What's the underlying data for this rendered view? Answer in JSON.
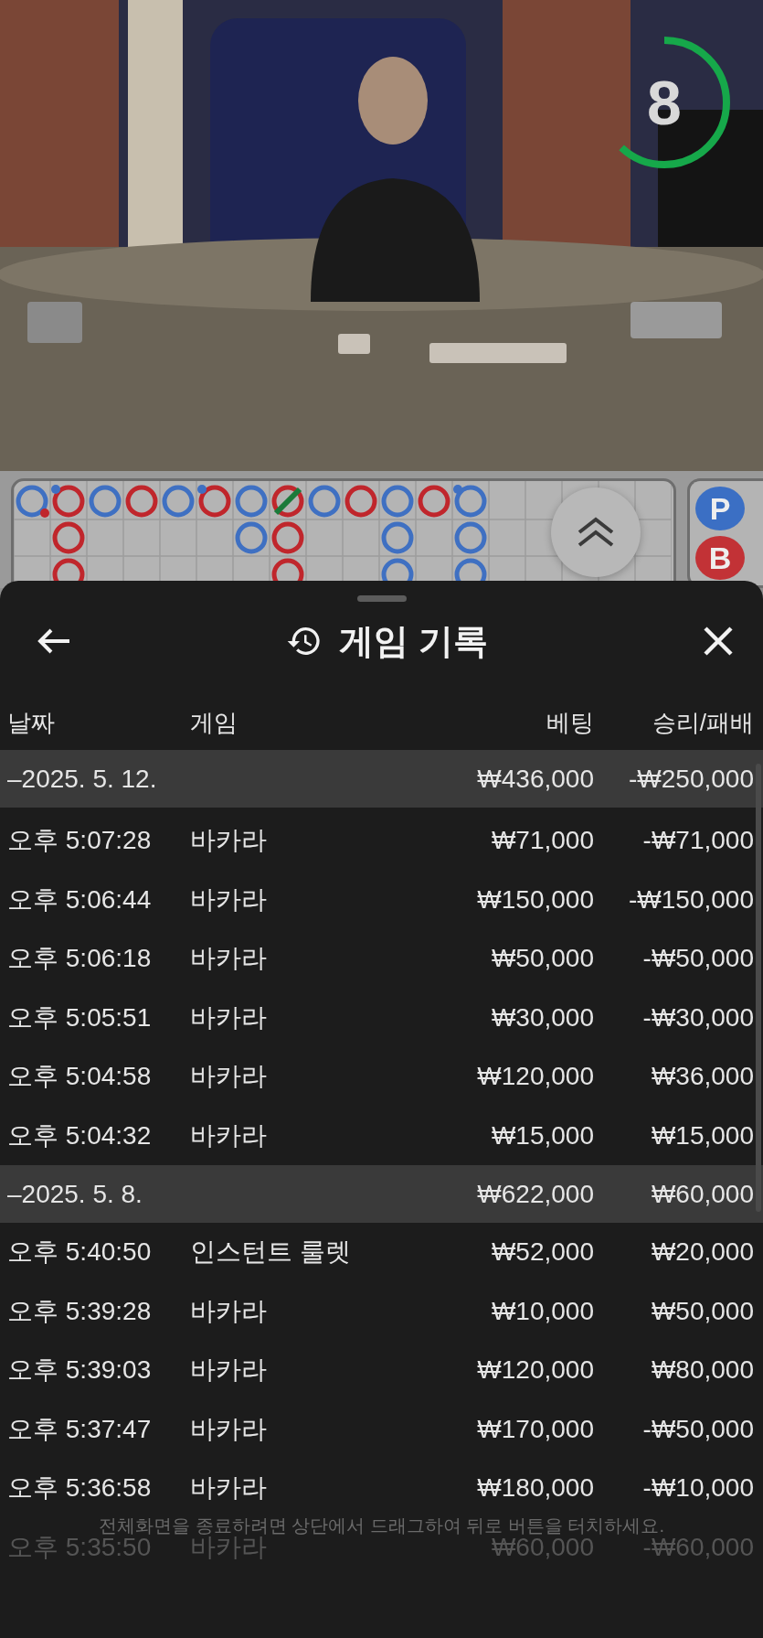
{
  "video": {
    "countdown": {
      "value": "8",
      "level": 0.62
    }
  },
  "scoreboard": {
    "columns": [
      [
        {
          "kind": "player-with-banker-pair"
        }
      ],
      [
        {
          "kind": "banker-with-player-pair"
        },
        {
          "kind": "banker"
        },
        {
          "kind": "banker"
        }
      ],
      [
        {
          "kind": "player"
        }
      ],
      [
        {
          "kind": "banker"
        }
      ],
      [
        {
          "kind": "player"
        }
      ],
      [
        {
          "kind": "banker-with-player-pair"
        }
      ],
      [
        {
          "kind": "player"
        },
        {
          "kind": "player"
        }
      ],
      [
        {
          "kind": "banker-with-tie"
        },
        {
          "kind": "banker"
        },
        {
          "kind": "banker"
        }
      ],
      [
        {
          "kind": "player"
        }
      ],
      [
        {
          "kind": "banker"
        }
      ],
      [
        {
          "kind": "player"
        },
        {
          "kind": "player"
        },
        {
          "kind": "player"
        }
      ],
      [
        {
          "kind": "banker"
        }
      ],
      [
        {
          "kind": "player-with-player-pair"
        },
        {
          "kind": "player"
        },
        {
          "kind": "player"
        }
      ]
    ]
  },
  "side_buttons": [
    {
      "label": "P",
      "kind": "player"
    },
    {
      "label": "B",
      "kind": "banker"
    }
  ],
  "sheet": {
    "title": "게임 기록",
    "columns": [
      "날짜",
      "게임",
      "베팅",
      "승리/패배"
    ],
    "groups": [
      {
        "date": "–2025. 5. 12.",
        "bet": "₩436,000",
        "result": "-₩250,000",
        "rows": [
          {
            "time": "오후 5:07:28",
            "game": "바카라",
            "bet": "₩71,000",
            "result": "-₩71,000",
            "faded": false
          },
          {
            "time": "오후 5:06:44",
            "game": "바카라",
            "bet": "₩150,000",
            "result": "-₩150,000",
            "faded": false
          },
          {
            "time": "오후 5:06:18",
            "game": "바카라",
            "bet": "₩50,000",
            "result": "-₩50,000",
            "faded": false
          },
          {
            "time": "오후 5:05:51",
            "game": "바카라",
            "bet": "₩30,000",
            "result": "-₩30,000",
            "faded": false
          },
          {
            "time": "오후 5:04:58",
            "game": "바카라",
            "bet": "₩120,000",
            "result": "₩36,000",
            "faded": false
          },
          {
            "time": "오후 5:04:32",
            "game": "바카라",
            "bet": "₩15,000",
            "result": "₩15,000",
            "faded": false
          }
        ]
      },
      {
        "date": "–2025. 5. 8.",
        "bet": "₩622,000",
        "result": "₩60,000",
        "rows": [
          {
            "time": "오후 5:40:50",
            "game": "인스턴트 룰렛",
            "bet": "₩52,000",
            "result": "₩20,000",
            "faded": false
          },
          {
            "time": "오후 5:39:28",
            "game": "바카라",
            "bet": "₩10,000",
            "result": "₩50,000",
            "faded": false
          },
          {
            "time": "오후 5:39:03",
            "game": "바카라",
            "bet": "₩120,000",
            "result": "₩80,000",
            "faded": false
          },
          {
            "time": "오후 5:37:47",
            "game": "바카라",
            "bet": "₩170,000",
            "result": "-₩50,000",
            "faded": false
          },
          {
            "time": "오후 5:36:58",
            "game": "바카라",
            "bet": "₩180,000",
            "result": "-₩10,000",
            "faded": false
          },
          {
            "time": "오후 5:35:50",
            "game": "바카라",
            "bet": "₩60,000",
            "result": "-₩60,000",
            "faded": true
          }
        ]
      }
    ],
    "toast": "전체화면을 종료하려면 상단에서 드래그하여 뒤로 버튼을 터치하세요."
  }
}
